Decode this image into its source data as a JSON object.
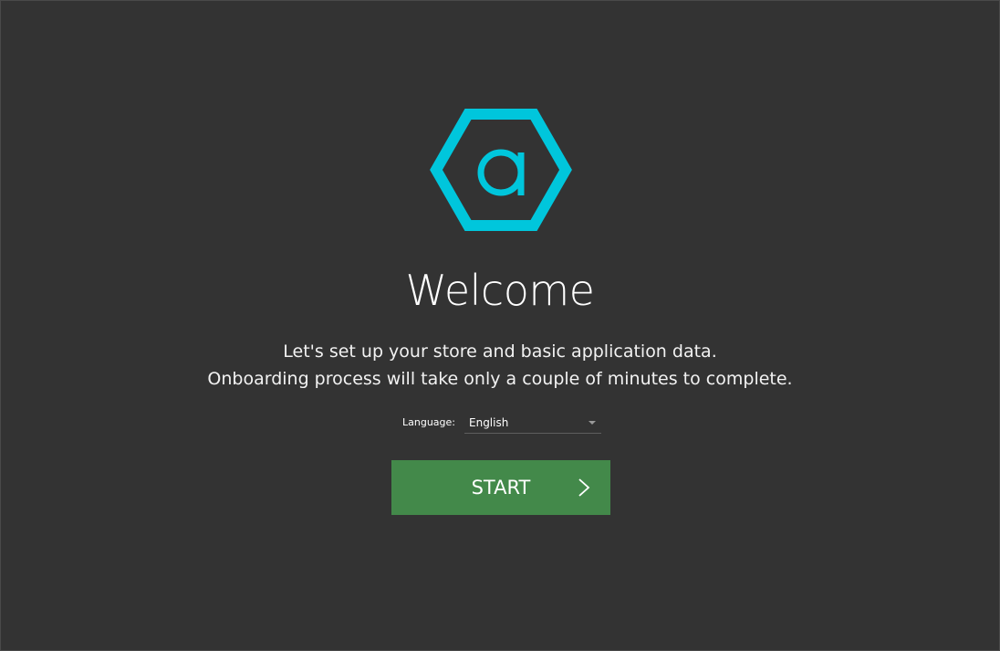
{
  "welcome": {
    "title": "Welcome",
    "line1": "Let's set up your store and basic application data.",
    "line2": "Onboarding process will take only a couple of minutes to complete."
  },
  "language": {
    "label": "Language:",
    "selected": "English"
  },
  "start": {
    "label": "START"
  },
  "icons": {
    "logo": "hexagon-a-logo-icon",
    "dropdown": "caret-down-icon",
    "arrow": "chevron-right-icon"
  },
  "colors": {
    "background": "#333333",
    "logo": "#00c6dc",
    "button": "#43894a"
  }
}
